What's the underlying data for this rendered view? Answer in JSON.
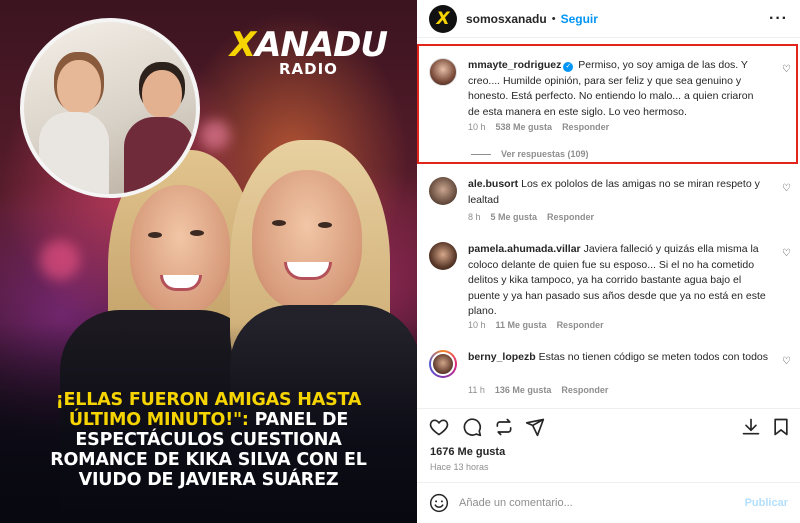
{
  "post": {
    "logo_brand": "XANADU",
    "logo_sub": "RADIO",
    "headline_yellow": "¡Ellas fueron amigas hasta último minuto!\":",
    "headline_white": " panel de espectáculos cuestiona romance de Kika Silva con el viudo de Javiera Suárez"
  },
  "header": {
    "username": "somosxanadu",
    "separator": "•",
    "follow_label": "Seguir",
    "more_label": "···",
    "avatar_letter": "X"
  },
  "comments": [
    {
      "username": "mmayte_rodriguez",
      "verified": true,
      "text": "Permiso, yo soy amiga de las dos. Y creo.... Humilde opinión, para ser feliz y que sea genuino y honesto. Está perfecto. No entiendo lo malo... a quien criaron de esta manera en este siglo. Lo veo hermoso.",
      "time": "10 h",
      "likes": "538 Me gusta",
      "reply": "Responder",
      "view_replies": "Ver respuestas (109)"
    },
    {
      "username": "ale.busort",
      "text": "Los ex pololos de las amigas no se miran respeto y lealtad",
      "time": "8 h",
      "likes": "5 Me gusta",
      "reply": "Responder"
    },
    {
      "username": "pamela.ahumada.villar",
      "text": "Javiera falleció y quizás ella misma la coloco delante de quien fue su esposo... Si el no ha cometido delitos y kika tampoco, ya ha corrido bastante agua bajo el puente y ya han pasado sus años desde que ya no está en este plano.",
      "time": "10 h",
      "likes": "11 Me gusta",
      "reply": "Responder"
    },
    {
      "username": "berny_lopezb",
      "text": "Estas no tienen código se meten todos con todos",
      "time": "11 h",
      "likes": "136 Me gusta",
      "reply": "Responder"
    }
  ],
  "footer": {
    "likes": "1676 Me gusta",
    "ago": "Hace 13 horas",
    "comment_placeholder": "Añade un comentario...",
    "publish_label": "Publicar"
  },
  "colors": {
    "accent_blue": "#0095f6",
    "highlight_red": "#e0261b",
    "brand_yellow": "#f5d400"
  }
}
